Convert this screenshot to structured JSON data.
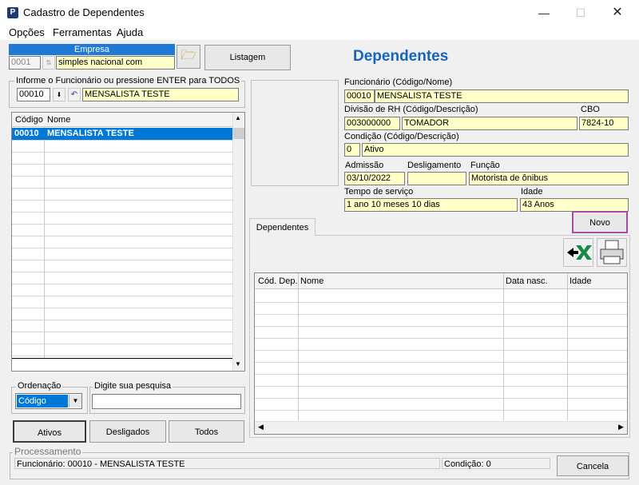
{
  "window": {
    "title": "Cadastro de Dependentes",
    "app_icon": "P"
  },
  "menu": {
    "opcoes": "Opções",
    "ferramentas": "Ferramentas",
    "ajuda": "Ajuda"
  },
  "empresa": {
    "label": "Empresa",
    "code": "0001",
    "name": "simples nacional com"
  },
  "listagem_label": "Listagem",
  "page_title": "Dependentes",
  "funcionario_group": {
    "legend": "Informe o Funcionário ou pressione ENTER para TODOS",
    "code": "00010",
    "name": "MENSALISTA TESTE"
  },
  "list": {
    "col_codigo": "Código",
    "col_nome": "Nome",
    "selected_code": "00010",
    "selected_name": "MENSALISTA TESTE"
  },
  "details": {
    "funcionario_label": "Funcionário (Código/Nome)",
    "funcionario_code": "00010",
    "funcionario_name": "MENSALISTA TESTE",
    "divisao_label": "Divisão de RH (Código/Descrição)",
    "divisao_code": "003000000",
    "divisao_desc": "TOMADOR",
    "cbo_label": "CBO",
    "cbo_value": "7824-10",
    "condicao_label": "Condição (Código/Descrição)",
    "condicao_code": "0",
    "condicao_desc": "Ativo",
    "admissao_label": "Admissão",
    "admissao_value": "03/10/2022",
    "desligamento_label": "Desligamento",
    "desligamento_value": "",
    "funcao_label": "Função",
    "funcao_value": "Motorista de ônibus",
    "tempo_label": "Tempo de serviço",
    "tempo_value": "1 ano 10 meses 10 dias",
    "idade_label": "Idade",
    "idade_value": "43 Anos"
  },
  "tab_dependentes": "Dependentes",
  "novo_label": "Novo",
  "dep_grid": {
    "col_cod": "Cód. Dep.",
    "col_nome": "Nome",
    "col_data": "Data nasc.",
    "col_idade": "Idade"
  },
  "ordenacao": {
    "legend": "Ordenação",
    "value": "Código"
  },
  "pesquisa": {
    "legend": "Digite sua pesquisa",
    "value": ""
  },
  "filter_buttons": {
    "ativos": "Ativos",
    "desligados": "Desligados",
    "todos": "Todos"
  },
  "processamento": {
    "legend": "Processamento",
    "status": "Funcionário: 00010 - MENSALISTA TESTE",
    "condicao": "Condição: 0"
  },
  "cancela_label": "Cancela",
  "colors": {
    "selection": "#0078d7",
    "input_bg": "#ffffc8",
    "title_blue": "#1565c0",
    "novo_border": "#a64ca6"
  }
}
